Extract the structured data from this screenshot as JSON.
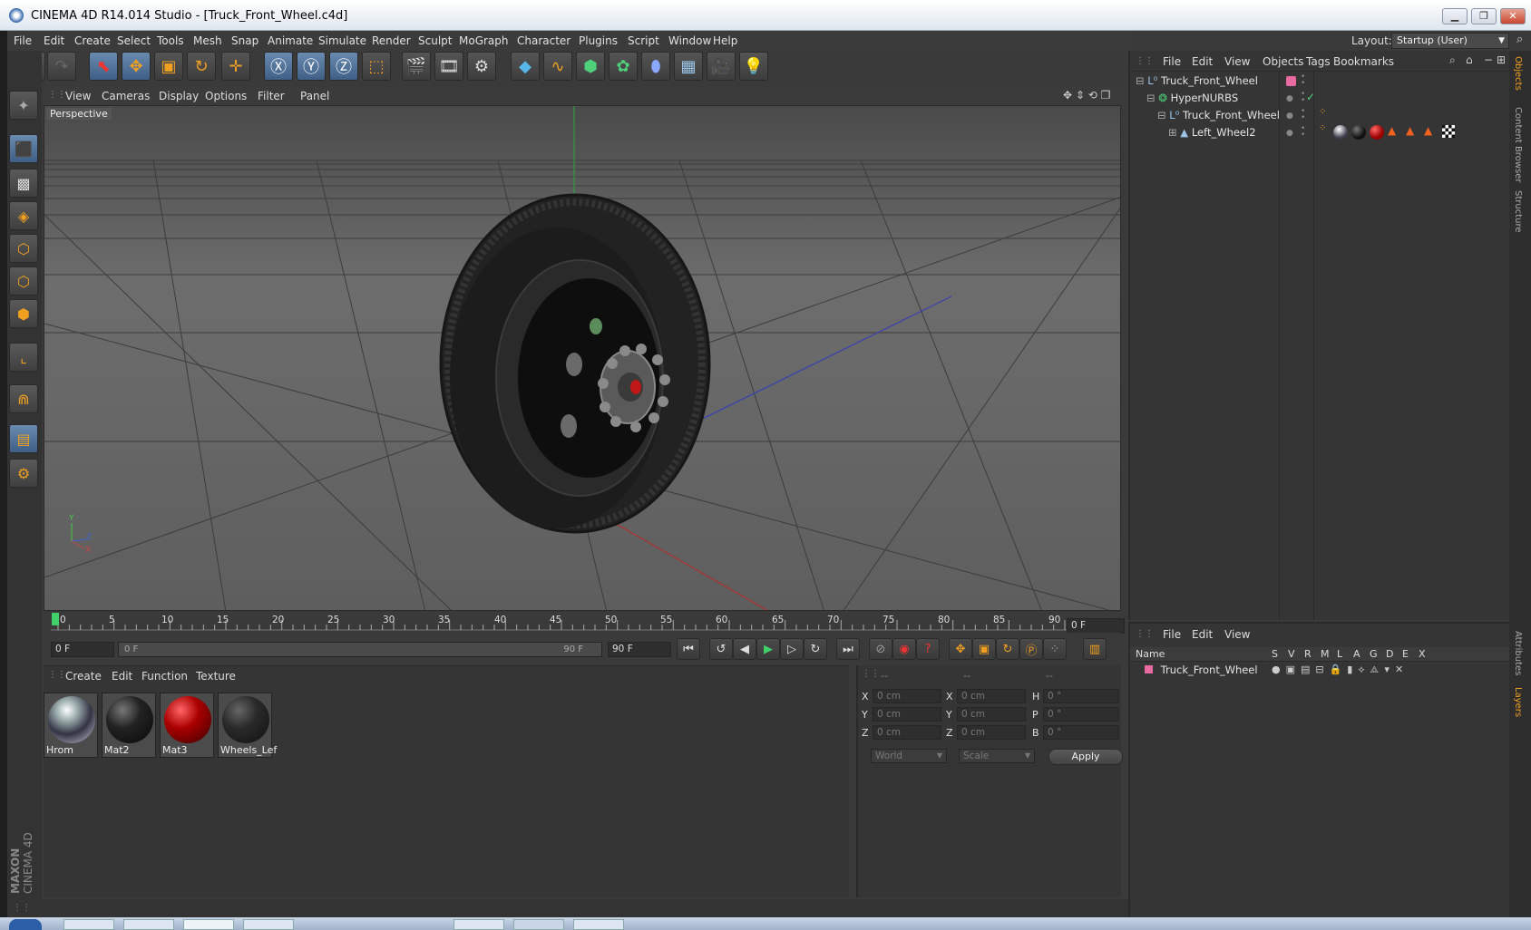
{
  "window": {
    "title": "CINEMA 4D R14.014 Studio - [Truck_Front_Wheel.c4d]"
  },
  "menubar": [
    "File",
    "Edit",
    "Create",
    "Select",
    "Tools",
    "Mesh",
    "Snap",
    "Animate",
    "Simulate",
    "Render",
    "Sculpt",
    "MoGraph",
    "Character",
    "Plugins",
    "Script",
    "Window",
    "Help"
  ],
  "layout": {
    "label": "Layout:",
    "value": "Startup (User)"
  },
  "viewport": {
    "menu": [
      "View",
      "Cameras",
      "Display",
      "Options",
      "Filter",
      "Panel"
    ],
    "label": "Perspective"
  },
  "timeline": {
    "ticks": [
      "0",
      "5",
      "10",
      "15",
      "20",
      "25",
      "30",
      "35",
      "40",
      "45",
      "50",
      "55",
      "60",
      "65",
      "70",
      "75",
      "80",
      "85",
      "90"
    ],
    "current_frame": "0 F",
    "start_field": "0 F",
    "range_start": "0 F",
    "range_end": "90 F",
    "end_field": "90 F"
  },
  "materials": {
    "menu": [
      "Create",
      "Edit",
      "Function",
      "Texture"
    ],
    "items": [
      {
        "name": "Hrom",
        "kind": "chrome"
      },
      {
        "name": "Mat2",
        "kind": "black"
      },
      {
        "name": "Mat3",
        "kind": "red"
      },
      {
        "name": "Wheels_Lef",
        "kind": "darkgray"
      }
    ]
  },
  "coords": {
    "headers": [
      "--",
      "--",
      "--"
    ],
    "rows": [
      {
        "a": "X",
        "av": "0 cm",
        "b": "X",
        "bv": "0 cm",
        "c": "H",
        "cv": "0 °"
      },
      {
        "a": "Y",
        "av": "0 cm",
        "b": "Y",
        "bv": "0 cm",
        "c": "P",
        "cv": "0 °"
      },
      {
        "a": "Z",
        "av": "0 cm",
        "b": "Z",
        "bv": "0 cm",
        "c": "B",
        "cv": "0 °"
      }
    ],
    "mode1": "World",
    "mode2": "Scale",
    "apply": "Apply"
  },
  "objects": {
    "menu": [
      "File",
      "Edit",
      "View",
      "Objects",
      "Tags",
      "Bookmarks"
    ],
    "tree": [
      {
        "name": "Truck_Front_Wheel",
        "indent": 0
      },
      {
        "name": "HyperNURBS",
        "indent": 1
      },
      {
        "name": "Truck_Front_Wheel",
        "indent": 2
      },
      {
        "name": "Left_Wheel2",
        "indent": 3
      }
    ]
  },
  "layers": {
    "menu": [
      "File",
      "Edit",
      "View"
    ],
    "col_name": "Name",
    "cols": [
      "S",
      "V",
      "R",
      "M",
      "L",
      "A",
      "G",
      "D",
      "E",
      "X"
    ],
    "rows": [
      "Truck_Front_Wheel"
    ]
  },
  "right_tabs": [
    "Objects",
    "Content Browser",
    "Structure",
    "Attributes",
    "Layers"
  ],
  "brand": {
    "maxon": "MAXON",
    "product": "CINEMA 4D"
  },
  "colors": {
    "accent": "#f0a020",
    "selected": "#4f6f96",
    "layer_color": "#e86aa0"
  }
}
